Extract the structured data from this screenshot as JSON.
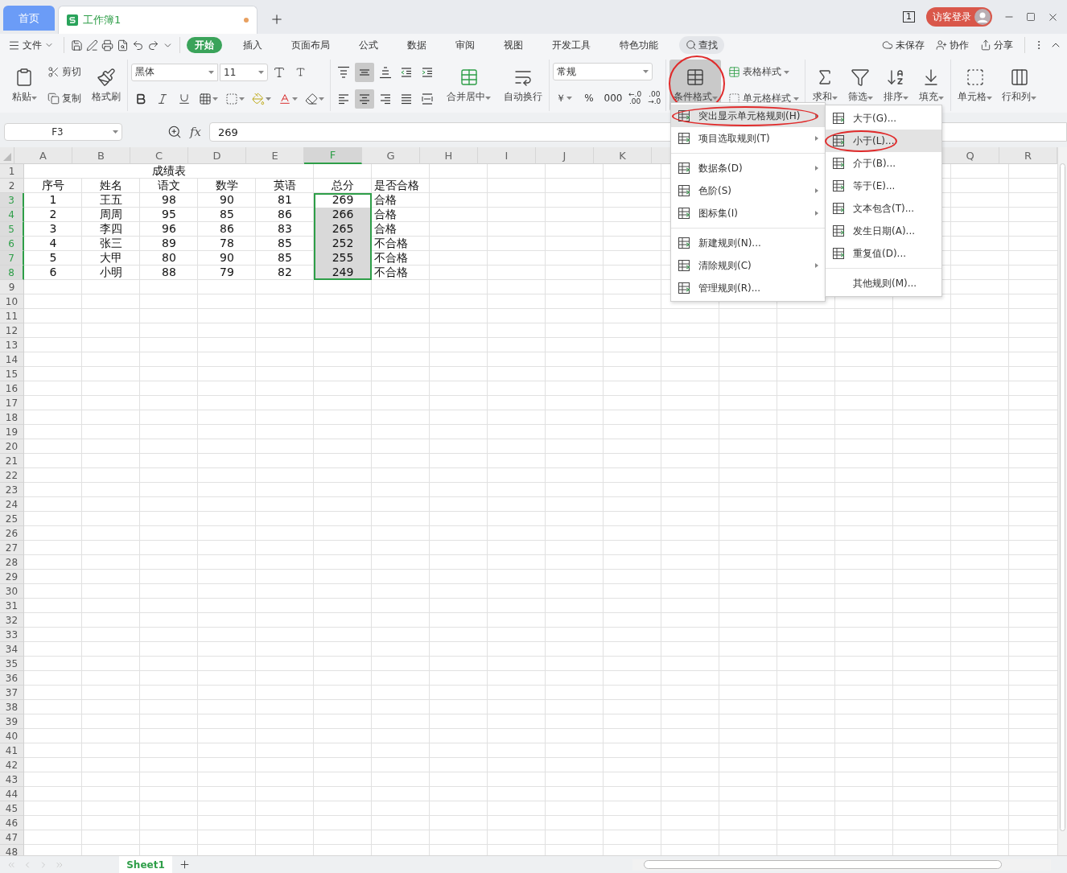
{
  "title_bar": {
    "tabs": [
      {
        "label": "首页",
        "kind": "home",
        "selected": false,
        "unsaved": false
      },
      {
        "label": "工作簿1",
        "kind": "document",
        "selected": true,
        "unsaved": true
      }
    ],
    "page_counter": "1",
    "account": "访客登录"
  },
  "menu_bar": {
    "file": "文件",
    "tabs": [
      {
        "label": "开始",
        "selected": true
      },
      {
        "label": "插入",
        "selected": false
      },
      {
        "label": "页面布局",
        "selected": false
      },
      {
        "label": "公式",
        "selected": false
      },
      {
        "label": "数据",
        "selected": false
      },
      {
        "label": "审阅",
        "selected": false
      },
      {
        "label": "视图",
        "selected": false
      },
      {
        "label": "开发工具",
        "selected": false
      },
      {
        "label": "特色功能",
        "selected": false
      }
    ],
    "search": "查找",
    "actions": [
      {
        "kind": "cloud",
        "label": "未保存"
      },
      {
        "kind": "collab",
        "label": "协作"
      },
      {
        "kind": "share",
        "label": "分享"
      }
    ]
  },
  "ribbon": {
    "paste": "粘贴",
    "cut": "剪切",
    "copy": "复制",
    "format_painter": "格式刷",
    "font_name": "黑体",
    "font_size": "11",
    "align_buttons": [
      {
        "kind": "top",
        "selected": false
      },
      {
        "kind": "middle",
        "selected": true
      },
      {
        "kind": "bottom",
        "selected": false
      },
      {
        "kind": "outdent",
        "selected": false
      },
      {
        "kind": "indent",
        "selected": false
      },
      {
        "kind": "left",
        "selected": false
      },
      {
        "kind": "center",
        "selected": true
      },
      {
        "kind": "right",
        "selected": false
      },
      {
        "kind": "justify",
        "selected": false
      },
      {
        "kind": "distributed",
        "selected": false
      }
    ],
    "merge": "合并居中",
    "wrap": "自动换行",
    "number_format": "常规",
    "number_symbols": [
      "￥",
      "%",
      "000"
    ],
    "decimal_buttons": [
      {
        "top": "←.0",
        "bottom": ".00"
      },
      {
        "top": ".00",
        "bottom": "→.0"
      }
    ],
    "conditional_format": {
      "label": "条件格式",
      "pressed": true,
      "circled": true
    },
    "table_style": "表格样式",
    "cell_style": "单元格样式",
    "tools": [
      {
        "kind": "sum",
        "label": "求和"
      },
      {
        "kind": "filter",
        "label": "筛选"
      },
      {
        "kind": "sort",
        "label": "排序"
      },
      {
        "kind": "fill",
        "label": "填充"
      },
      {
        "kind": "cell",
        "label": "单元格"
      },
      {
        "kind": "rowcol",
        "label": "行和列"
      }
    ]
  },
  "formula_bar": {
    "name_box": "F3",
    "fx": "fx",
    "formula": "269"
  },
  "sheet": {
    "columns": [
      {
        "label": "A",
        "selected": false
      },
      {
        "label": "B",
        "selected": false
      },
      {
        "label": "C",
        "selected": false
      },
      {
        "label": "D",
        "selected": false
      },
      {
        "label": "E",
        "selected": false
      },
      {
        "label": "F",
        "selected": true
      },
      {
        "label": "G",
        "selected": false
      },
      {
        "label": "H",
        "selected": false
      },
      {
        "label": "I",
        "selected": false
      },
      {
        "label": "J",
        "selected": false
      },
      {
        "label": "K",
        "selected": false
      }
    ],
    "columns_right": [
      {
        "label": "Q",
        "selected": false
      },
      {
        "label": "R",
        "selected": false
      }
    ],
    "rows": [
      {
        "number": "1",
        "selected": false
      },
      {
        "number": "2",
        "selected": false
      },
      {
        "number": "3",
        "selected": true
      },
      {
        "number": "4",
        "selected": true
      },
      {
        "number": "5",
        "selected": true
      },
      {
        "number": "6",
        "selected": true
      },
      {
        "number": "7",
        "selected": true
      },
      {
        "number": "8",
        "selected": true
      },
      {
        "number": "9",
        "selected": false
      },
      {
        "number": "10",
        "selected": false
      },
      {
        "number": "11",
        "selected": false
      },
      {
        "number": "12",
        "selected": false
      },
      {
        "number": "13",
        "selected": false
      },
      {
        "number": "14",
        "selected": false
      },
      {
        "number": "15",
        "selected": false
      },
      {
        "number": "16",
        "selected": false
      },
      {
        "number": "17",
        "selected": false
      },
      {
        "number": "18",
        "selected": false
      },
      {
        "number": "19",
        "selected": false
      },
      {
        "number": "20",
        "selected": false
      },
      {
        "number": "21",
        "selected": false
      },
      {
        "number": "22",
        "selected": false
      },
      {
        "number": "23",
        "selected": false
      },
      {
        "number": "24",
        "selected": false
      },
      {
        "number": "25",
        "selected": false
      },
      {
        "number": "26",
        "selected": false
      },
      {
        "number": "27",
        "selected": false
      },
      {
        "number": "28",
        "selected": false
      },
      {
        "number": "29",
        "selected": false
      },
      {
        "number": "30",
        "selected": false
      },
      {
        "number": "31",
        "selected": false
      },
      {
        "number": "32",
        "selected": false
      },
      {
        "number": "33",
        "selected": false
      },
      {
        "number": "34",
        "selected": false
      },
      {
        "number": "35",
        "selected": false
      },
      {
        "number": "36",
        "selected": false
      },
      {
        "number": "37",
        "selected": false
      },
      {
        "number": "38",
        "selected": false
      },
      {
        "number": "39",
        "selected": false
      },
      {
        "number": "40",
        "selected": false
      },
      {
        "number": "41",
        "selected": false
      },
      {
        "number": "42",
        "selected": false
      },
      {
        "number": "43",
        "selected": false
      },
      {
        "number": "44",
        "selected": false
      },
      {
        "number": "45",
        "selected": false
      },
      {
        "number": "46",
        "selected": false
      },
      {
        "number": "47",
        "selected": false
      },
      {
        "number": "48",
        "selected": false
      }
    ],
    "title": "成绩表",
    "headers": [
      "序号",
      "姓名",
      "语文",
      "数学",
      "英语",
      "总分",
      "是否合格"
    ],
    "records": [
      {
        "cells": [
          "1",
          "王五",
          "98",
          "90",
          "81",
          "269",
          "合格"
        ],
        "selected": true,
        "active": true
      },
      {
        "cells": [
          "2",
          "周周",
          "95",
          "85",
          "86",
          "266",
          "合格"
        ],
        "selected": true,
        "active": false
      },
      {
        "cells": [
          "3",
          "李四",
          "96",
          "86",
          "83",
          "265",
          "合格"
        ],
        "selected": true,
        "active": false
      },
      {
        "cells": [
          "4",
          "张三",
          "89",
          "78",
          "85",
          "252",
          "不合格"
        ],
        "selected": true,
        "active": false
      },
      {
        "cells": [
          "5",
          "大甲",
          "80",
          "90",
          "85",
          "255",
          "不合格"
        ],
        "selected": true,
        "active": false
      },
      {
        "cells": [
          "6",
          "小明",
          "88",
          "79",
          "82",
          "249",
          "不合格"
        ],
        "selected": true,
        "active": false
      }
    ]
  },
  "context_menu": {
    "groups": [
      [
        {
          "label": "突出显示单元格规则(H)",
          "has_submenu": true,
          "highlighted": true,
          "circled": true
        },
        {
          "label": "项目选取规则(T)",
          "has_submenu": true,
          "highlighted": false,
          "circled": false
        }
      ],
      [
        {
          "label": "数据条(D)",
          "has_submenu": true,
          "highlighted": false,
          "circled": false
        },
        {
          "label": "色阶(S)",
          "has_submenu": true,
          "highlighted": false,
          "circled": false
        },
        {
          "label": "图标集(I)",
          "has_submenu": true,
          "highlighted": false,
          "circled": false
        }
      ],
      [
        {
          "label": "新建规则(N)...",
          "has_submenu": false,
          "highlighted": false,
          "circled": false
        },
        {
          "label": "清除规则(C)",
          "has_submenu": true,
          "highlighted": false,
          "circled": false
        },
        {
          "label": "管理规则(R)...",
          "has_submenu": false,
          "highlighted": false,
          "circled": false
        }
      ]
    ]
  },
  "submenu": {
    "groups": [
      [
        {
          "label": "大于(G)...",
          "has_icon": true,
          "highlighted": false,
          "circled": false
        },
        {
          "label": "小于(L)...",
          "has_icon": true,
          "highlighted": true,
          "circled": true
        },
        {
          "label": "介于(B)...",
          "has_icon": true,
          "highlighted": false,
          "circled": false
        },
        {
          "label": "等于(E)...",
          "has_icon": true,
          "highlighted": false,
          "circled": false
        },
        {
          "label": "文本包含(T)...",
          "has_icon": true,
          "highlighted": false,
          "circled": false
        },
        {
          "label": "发生日期(A)...",
          "has_icon": true,
          "highlighted": false,
          "circled": false
        },
        {
          "label": "重复值(D)...",
          "has_icon": true,
          "highlighted": false,
          "circled": false
        }
      ],
      [
        {
          "label": "其他规则(M)...",
          "has_icon": false,
          "highlighted": false,
          "circled": false
        }
      ]
    ]
  },
  "sheet_tabs": [
    {
      "label": "Sheet1",
      "selected": true
    }
  ]
}
